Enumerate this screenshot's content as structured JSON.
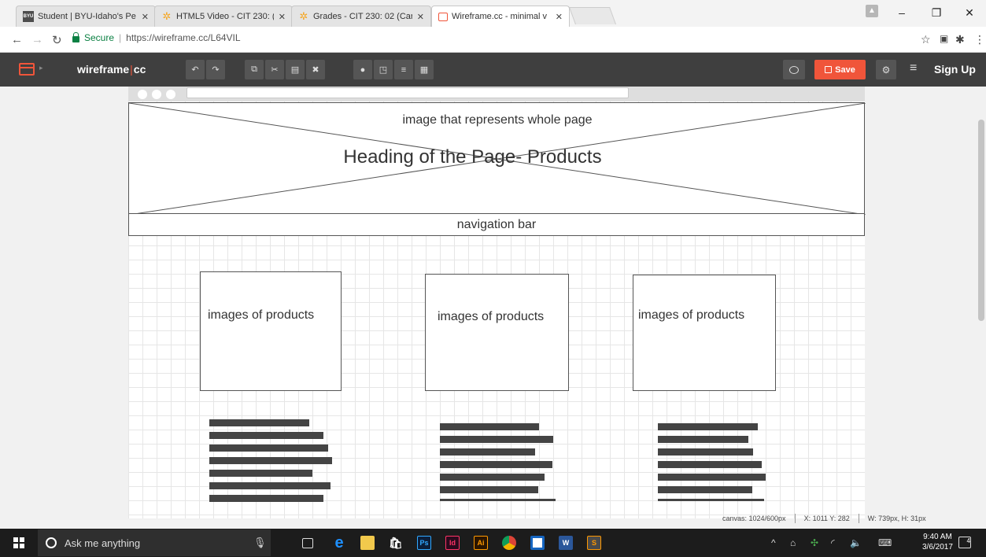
{
  "tabs": [
    {
      "title": "Student | BYU-Idaho's Pe",
      "icon": "byu-logo-icon",
      "active": false
    },
    {
      "title": "HTML5 Video - CIT 230: (",
      "icon": "spark-icon",
      "active": false
    },
    {
      "title": "Grades - CIT 230: 02 (Car",
      "icon": "spark-icon",
      "active": false
    },
    {
      "title": "Wireframe.cc - minimal v",
      "icon": "wireframe-logo-icon",
      "active": true
    }
  ],
  "address_bar": {
    "secure_label": "Secure",
    "url": "https://wireframe.cc/L64VIL"
  },
  "app": {
    "logo_left": "wireframe",
    "logo_divider": "|",
    "logo_right": "cc",
    "save_label": "Save",
    "signup_label": "Sign Up"
  },
  "wireframe": {
    "hero_caption": "image that represents whole page",
    "hero_heading": "Heading of the Page- Products",
    "nav_label": "navigation bar",
    "products": [
      {
        "label": "images of products"
      },
      {
        "label": "images of products"
      },
      {
        "label": "images of products"
      }
    ]
  },
  "statusbar": {
    "canvas": "canvas: 1024/600px",
    "coords": "X: 1011 Y: 282",
    "size": "W: 739px, H: 31px"
  },
  "taskbar": {
    "search_placeholder": "Ask me anything",
    "time": "9:40 AM",
    "date": "3/6/2017",
    "notification_count": "4"
  },
  "colors": {
    "accent": "#f0553a",
    "toolbar": "#3f3f3f",
    "secure": "#0b8043"
  }
}
